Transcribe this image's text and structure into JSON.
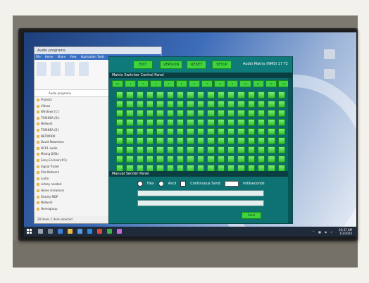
{
  "explorer": {
    "title": "Audio programs",
    "tabs": [
      "File",
      "Home",
      "Share",
      "View",
      "Application Tools"
    ],
    "address": "Audio programs",
    "nav": [
      "Projects",
      "Videos",
      "Windows (C:)",
      "TOSHIBA (D:)",
      "Network",
      "TOSHIBA (E:)",
      "NETWORK",
      "David Newmann",
      "DCK1 audio",
      "Mixing DVDs",
      "Sony Ericsson(#1)",
      "Signal Trader",
      "Rita Network",
      "audio",
      "sidney needed",
      "Home streamers",
      "Sharity MDP",
      "Network",
      "Homegroup"
    ],
    "status": "28 items    1 item selected"
  },
  "control": {
    "top_buttons": [
      "EXIT",
      "VERSION",
      "RESET",
      "SETUP"
    ],
    "window_title": "Audio Matrix (NMS) 17 T2",
    "panel_title": "Matrix Switcher Control Panel",
    "tabs": [
      "ALL",
      "1",
      "2",
      "3",
      "4",
      "5",
      "6",
      "7",
      "8",
      "9",
      "10",
      "11",
      "12",
      "13"
    ],
    "manual_title": "Manual Sender Panel",
    "radio_hex": "Hex",
    "radio_ascii": "Ascii",
    "continuous_label": "Continuous Send",
    "ms_label": "milliseconds",
    "send_label": "Send"
  },
  "taskbar": {
    "time": "10:37 AM",
    "date": "1/1/2024"
  }
}
